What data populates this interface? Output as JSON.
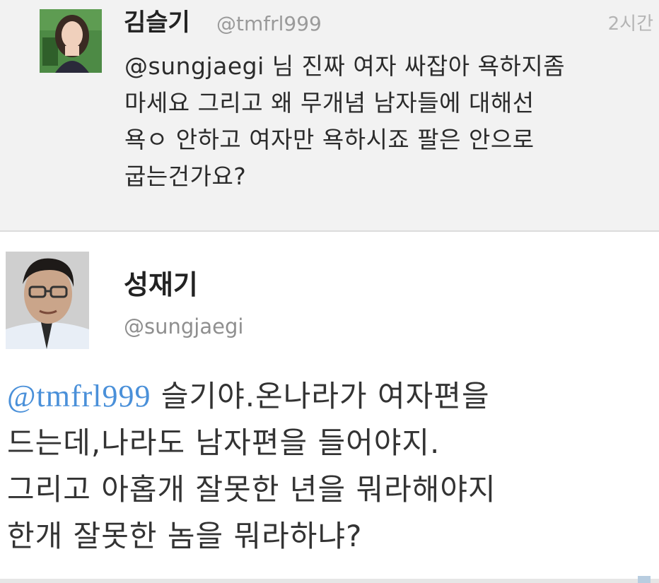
{
  "reply_tweet": {
    "display_name": "김슬기",
    "handle": "@tmfrl999",
    "timestamp": "2시간",
    "avatar_icon": "profile-photo-woman",
    "text_mention": "@sungjaegi",
    "text_lines": [
      " 님 진짜 여자 싸잡아 욕하지좀",
      "마세요 그리고 왜 무개념 남자들에 대해선",
      "욕ㅇ 안하고 여자만 욕하시죠 팔은 안으로",
      "굽는건가요?"
    ]
  },
  "main_tweet": {
    "display_name": "성재기",
    "handle": "@sungjaegi",
    "avatar_icon": "profile-photo-man-glasses",
    "text_mention": "@tmfrl999",
    "text_lines": [
      " 슬기야.온나라가 여자편을",
      "드는데,나라도 남자편을 들어야지.",
      "그리고 아홉개 잘못한 년을 뭐라해야지",
      "한개 잘못한 놈을 뭐라하냐?"
    ]
  },
  "colors": {
    "mention": "#4a90d9",
    "reply_background": "#f2f2f2",
    "main_background": "#ffffff"
  }
}
